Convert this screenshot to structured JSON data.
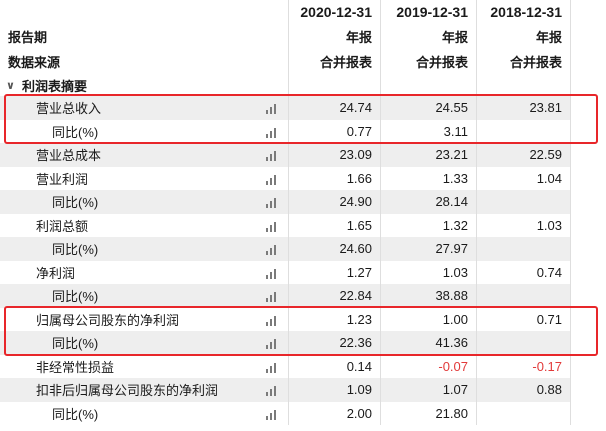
{
  "header": {
    "row1": {
      "label": "",
      "years": [
        "2020-12-31",
        "2019-12-31",
        "2018-12-31"
      ]
    },
    "row2": {
      "label": "报告期",
      "values": [
        "年报",
        "年报",
        "年报"
      ]
    },
    "row3": {
      "label": "数据来源",
      "values": [
        "合并报表",
        "合并报表",
        "合并报表"
      ]
    }
  },
  "section": {
    "caret": "∨",
    "title": "利润表摘要"
  },
  "colors": {
    "negative": "#e23a3a",
    "highlight_box": "#e8262a",
    "row_shade": "#eeeeee"
  },
  "rows": [
    {
      "label": "营业总收入",
      "sub": false,
      "values": [
        "24.74",
        "24.55",
        "23.81"
      ]
    },
    {
      "label": "同比(%)",
      "sub": true,
      "values": [
        "0.77",
        "3.11",
        ""
      ]
    },
    {
      "label": "营业总成本",
      "sub": false,
      "values": [
        "23.09",
        "23.21",
        "22.59"
      ]
    },
    {
      "label": "营业利润",
      "sub": false,
      "values": [
        "1.66",
        "1.33",
        "1.04"
      ]
    },
    {
      "label": "同比(%)",
      "sub": true,
      "values": [
        "24.90",
        "28.14",
        ""
      ]
    },
    {
      "label": "利润总额",
      "sub": false,
      "values": [
        "1.65",
        "1.32",
        "1.03"
      ]
    },
    {
      "label": "同比(%)",
      "sub": true,
      "values": [
        "24.60",
        "27.97",
        ""
      ]
    },
    {
      "label": "净利润",
      "sub": false,
      "values": [
        "1.27",
        "1.03",
        "0.74"
      ]
    },
    {
      "label": "同比(%)",
      "sub": true,
      "values": [
        "22.84",
        "38.88",
        ""
      ]
    },
    {
      "label": "归属母公司股东的净利润",
      "sub": false,
      "values": [
        "1.23",
        "1.00",
        "0.71"
      ]
    },
    {
      "label": "同比(%)",
      "sub": true,
      "values": [
        "22.36",
        "41.36",
        ""
      ]
    },
    {
      "label": "非经常性损益",
      "sub": false,
      "values": [
        "0.14",
        "-0.07",
        "-0.17"
      ]
    },
    {
      "label": "扣非后归属母公司股东的净利润",
      "sub": false,
      "values": [
        "1.09",
        "1.07",
        "0.88"
      ]
    },
    {
      "label": "同比(%)",
      "sub": true,
      "values": [
        "2.00",
        "21.80",
        ""
      ]
    }
  ],
  "highlights": [
    {
      "from_row": 0,
      "to_row": 1
    },
    {
      "from_row": 9,
      "to_row": 10
    }
  ]
}
